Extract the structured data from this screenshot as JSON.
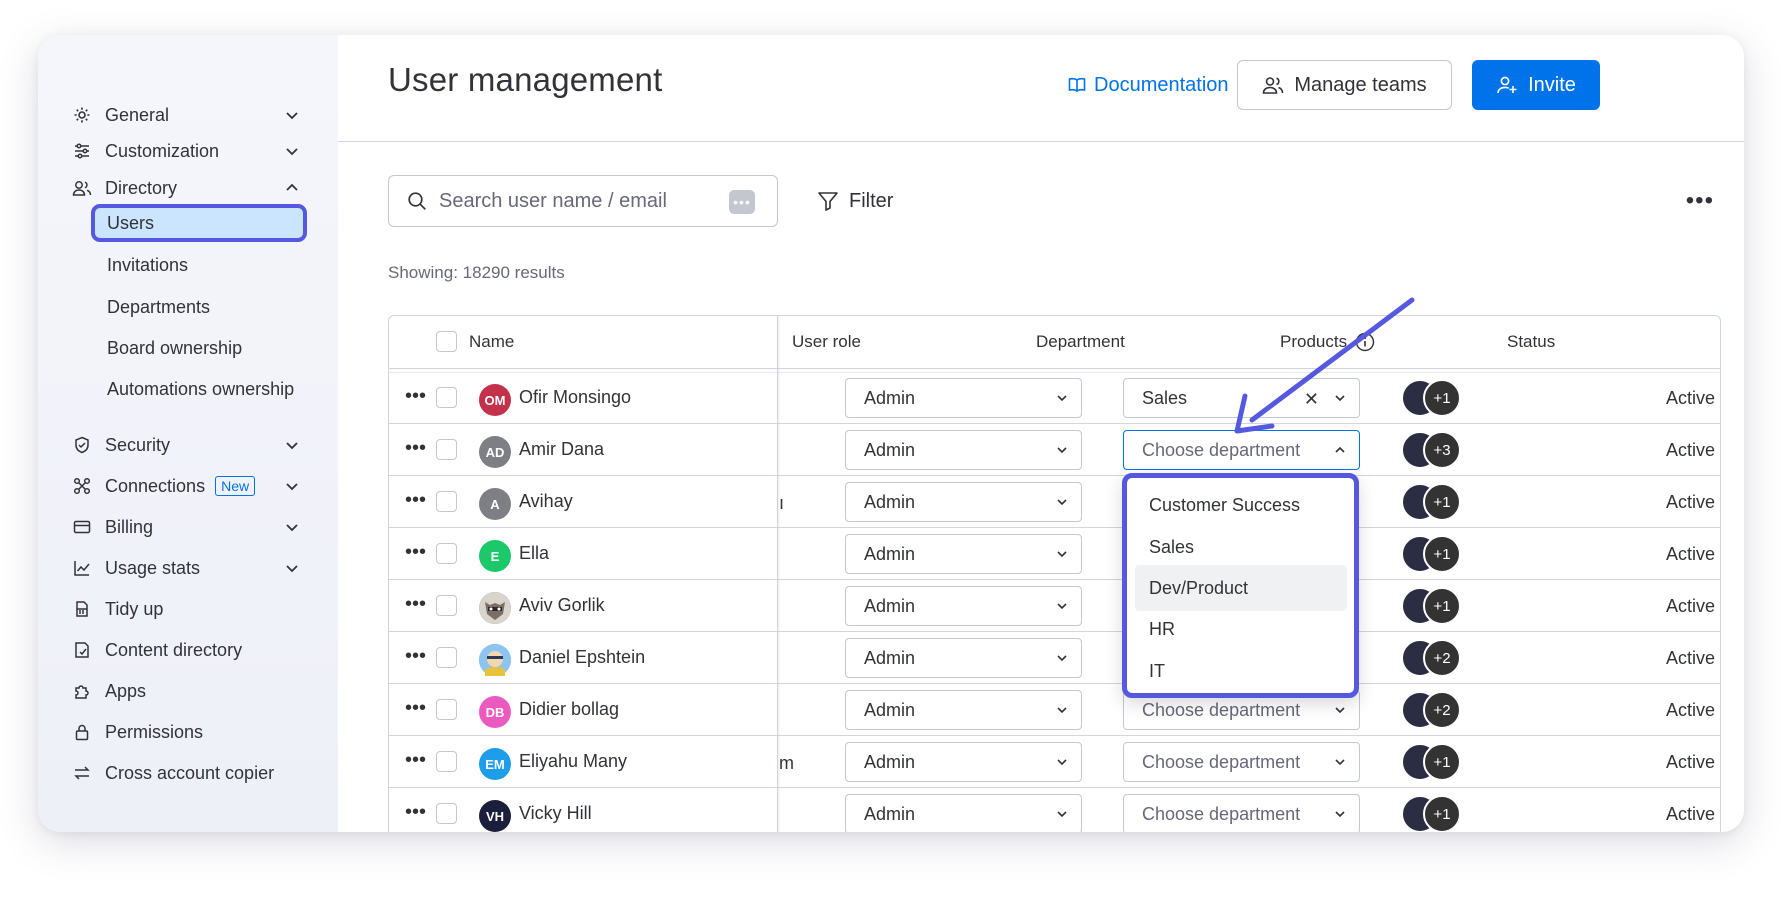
{
  "sidebar": {
    "items": [
      {
        "label": "General",
        "icon": "gear-icon",
        "expandable": true
      },
      {
        "label": "Customization",
        "icon": "sliders-icon",
        "expandable": true
      },
      {
        "label": "Directory",
        "icon": "people-icon",
        "expanded": true
      },
      {
        "label": "Security",
        "icon": "shield-icon",
        "expandable": true
      },
      {
        "label": "Connections",
        "icon": "connections-icon",
        "expandable": true,
        "badge": "New"
      },
      {
        "label": "Billing",
        "icon": "credit-card-icon",
        "expandable": true
      },
      {
        "label": "Usage stats",
        "icon": "chart-icon",
        "expandable": true
      },
      {
        "label": "Tidy up",
        "icon": "broom-icon"
      },
      {
        "label": "Content directory",
        "icon": "content-icon"
      },
      {
        "label": "Apps",
        "icon": "puzzle-icon"
      },
      {
        "label": "Permissions",
        "icon": "lock-icon"
      },
      {
        "label": "Cross account copier",
        "icon": "swap-icon"
      }
    ],
    "directory_sub": [
      {
        "label": "Users",
        "active": true
      },
      {
        "label": "Invitations"
      },
      {
        "label": "Departments"
      },
      {
        "label": "Board ownership"
      },
      {
        "label": "Automations ownership"
      }
    ]
  },
  "header": {
    "title": "User management",
    "documentation": "Documentation",
    "manage_teams": "Manage teams",
    "invite": "Invite"
  },
  "toolbar": {
    "search_placeholder": "Search user name / email",
    "filter": "Filter",
    "showing": "Showing: 18290 results"
  },
  "table": {
    "columns": [
      "Name",
      "User role",
      "Department",
      "Products",
      "Status"
    ],
    "rows": [
      {
        "initials": "OM",
        "name": "Ofir Monsingo",
        "avatar_color": "#c4314b",
        "role": "Admin",
        "department": "Sales",
        "products_extra": "+1",
        "status": "Active",
        "trunc": ""
      },
      {
        "initials": "AD",
        "name": "Amir Dana",
        "avatar_color": "#7e7e85",
        "role": "Admin",
        "department": "Choose department",
        "products_extra": "+3",
        "status": "Active",
        "trunc": ""
      },
      {
        "initials": "A",
        "name": "Avihay",
        "avatar_color": "#7e7e85",
        "role": "Admin",
        "department": "",
        "products_extra": "+1",
        "status": "Active",
        "trunc": "ı"
      },
      {
        "initials": "E",
        "name": "Ella",
        "avatar_color": "#1dc86a",
        "role": "Admin",
        "department": "",
        "products_extra": "+1",
        "status": "Active",
        "trunc": ""
      },
      {
        "initials": "",
        "name": "Aviv Gorlik",
        "avatar_color": "#8a7a6a",
        "role": "Admin",
        "department": "",
        "products_extra": "+1",
        "status": "Active",
        "trunc": ""
      },
      {
        "initials": "",
        "name": "Daniel Epshtein",
        "avatar_color": "#6aa9e8",
        "role": "Admin",
        "department": "",
        "products_extra": "+2",
        "status": "Active",
        "trunc": ""
      },
      {
        "initials": "DB",
        "name": "Didier bollag",
        "avatar_color": "#ec5abf",
        "role": "Admin",
        "department": "Choose department",
        "products_extra": "+2",
        "status": "Active",
        "trunc": ""
      },
      {
        "initials": "EM",
        "name": "Eliyahu Many",
        "avatar_color": "#1e9ee8",
        "role": "Admin",
        "department": "Choose department",
        "products_extra": "+1",
        "status": "Active",
        "trunc": "m"
      },
      {
        "initials": "VH",
        "name": "Vicky Hill",
        "avatar_color": "#1c1f3b",
        "role": "Admin",
        "department": "Choose department",
        "products_extra": "+1",
        "status": "Active",
        "trunc": ""
      }
    ]
  },
  "department_dropdown": {
    "options": [
      "Customer Success",
      "Sales",
      "Dev/Product",
      "HR",
      "IT"
    ],
    "highlighted": "Dev/Product"
  },
  "colors": {
    "accent": "#0073ea",
    "highlight": "#5559df"
  }
}
